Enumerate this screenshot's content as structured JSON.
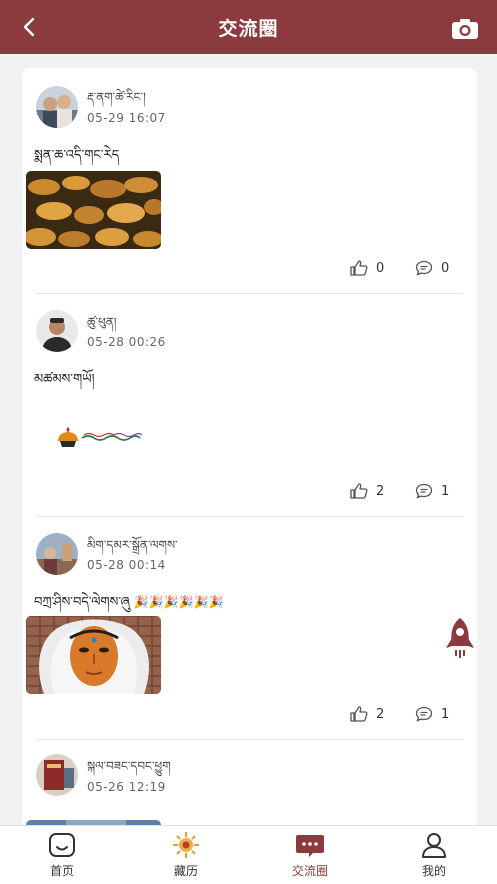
{
  "header": {
    "title": "交流圈",
    "back_icon": "chevron-left-icon",
    "camera_icon": "camera-icon",
    "bg_color": "#8b3a3e"
  },
  "posts": [
    {
      "username": "རྡ་ནག་ཚེ་རིང་།",
      "time": "05-29 16:07",
      "content": "སྨན་ཆ་འདི་གང་རེད",
      "likes": "0",
      "comments": "0"
    },
    {
      "username": "ཚུ་ཕུན།",
      "time": "05-28 00:26",
      "content": "མཚམས་གཡོ།",
      "likes": "2",
      "comments": "1"
    },
    {
      "username": "མིག་དམར་སྒྲོན་ལགས་",
      "time": "05-28 00:14",
      "content": "བཀྲ་ཤིས་བདེ་ལེགས་ཞུ",
      "emoji": "🎉🎉🎉🎉🎉🎉",
      "likes": "2",
      "comments": "1"
    },
    {
      "username": "སྐལ་བཟང་དབང་ཕྱུག",
      "time": "05-26 12:19"
    }
  ],
  "tabs": [
    {
      "label": "首页",
      "icon": "home-icon"
    },
    {
      "label": "藏历",
      "icon": "calendar-sun-icon"
    },
    {
      "label": "交流圈",
      "icon": "chat-bubble-icon"
    },
    {
      "label": "我的",
      "icon": "user-icon"
    }
  ],
  "active_tab": "交流圈",
  "accent_color": "#8b3a3e"
}
